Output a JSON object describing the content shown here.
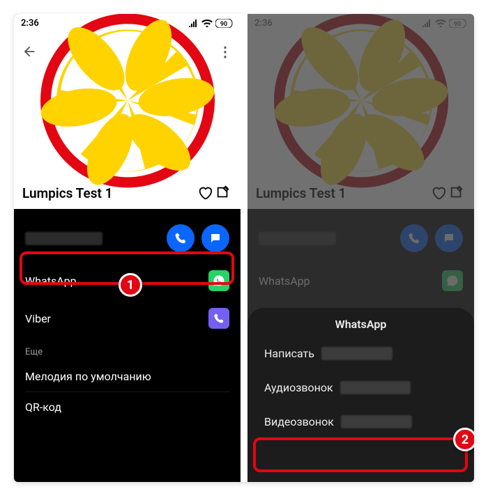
{
  "status": {
    "time": "2:36",
    "battery": "90"
  },
  "contact": {
    "name": "Lumpics Test 1"
  },
  "actions": {
    "whatsapp": "WhatsApp",
    "viber": "Viber"
  },
  "more": {
    "header": "Еще",
    "ringtone": "Мелодия по умолчанию",
    "qr": "QR-код"
  },
  "sheet": {
    "title": "WhatsApp",
    "write": "Написать",
    "audio": "Аудиозвонок",
    "video": "Видеозвонок"
  },
  "badges": {
    "one": "1",
    "two": "2"
  },
  "colors": {
    "accent": "#e30613",
    "whatsapp": "#25D366",
    "viber": "#7360F2",
    "blue": "#0a66ff"
  }
}
